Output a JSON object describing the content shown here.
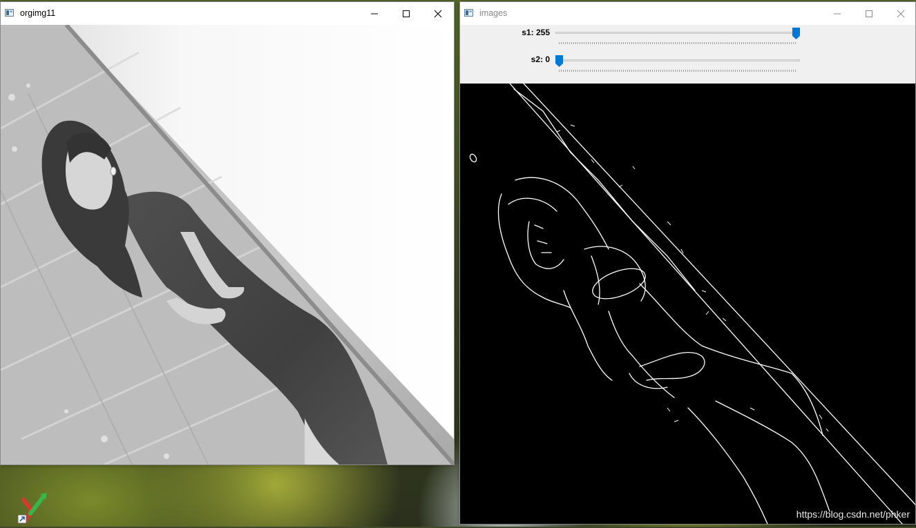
{
  "desktop": {
    "shortcut_icon": "xmind-shortcut-icon"
  },
  "window_orig": {
    "title": "orgimg11",
    "controls": [
      "minimize-icon",
      "maximize-icon",
      "close-icon"
    ],
    "image_description_icon": "grayscale-photo"
  },
  "window_edges": {
    "title": "images",
    "trackbars": [
      {
        "label": "s1: 255",
        "value": 255,
        "max": 255
      },
      {
        "label": "s2: 0",
        "value": 0,
        "max": 255
      }
    ],
    "watermark": "https://blog.csdn.net/phker"
  },
  "colors": {
    "accent": "#0078d7",
    "titlebar_bg": "#ffffff",
    "trackbar_bg": "#f0f0f0",
    "edge_bg": "#000000"
  }
}
